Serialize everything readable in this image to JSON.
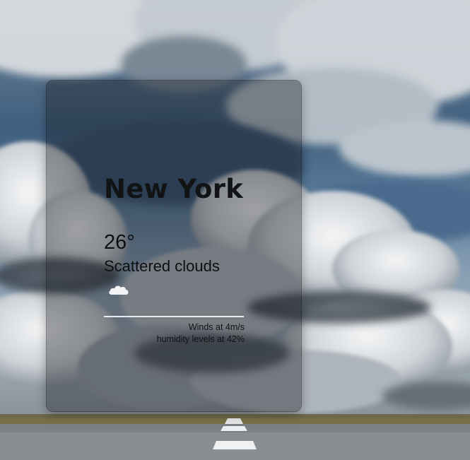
{
  "weather": {
    "city": "New York",
    "temperature": "26°",
    "condition": "Scattered clouds",
    "condition_icon": "cloud-icon",
    "wind": "Winds at 4m/s",
    "humidity": "humidity levels at 42%"
  },
  "background": {
    "description_icon": "cloudy-sky-road-photo"
  },
  "colors": {
    "card_tint": "#14181e",
    "text": "#111315",
    "divider": "#e8ebee"
  }
}
